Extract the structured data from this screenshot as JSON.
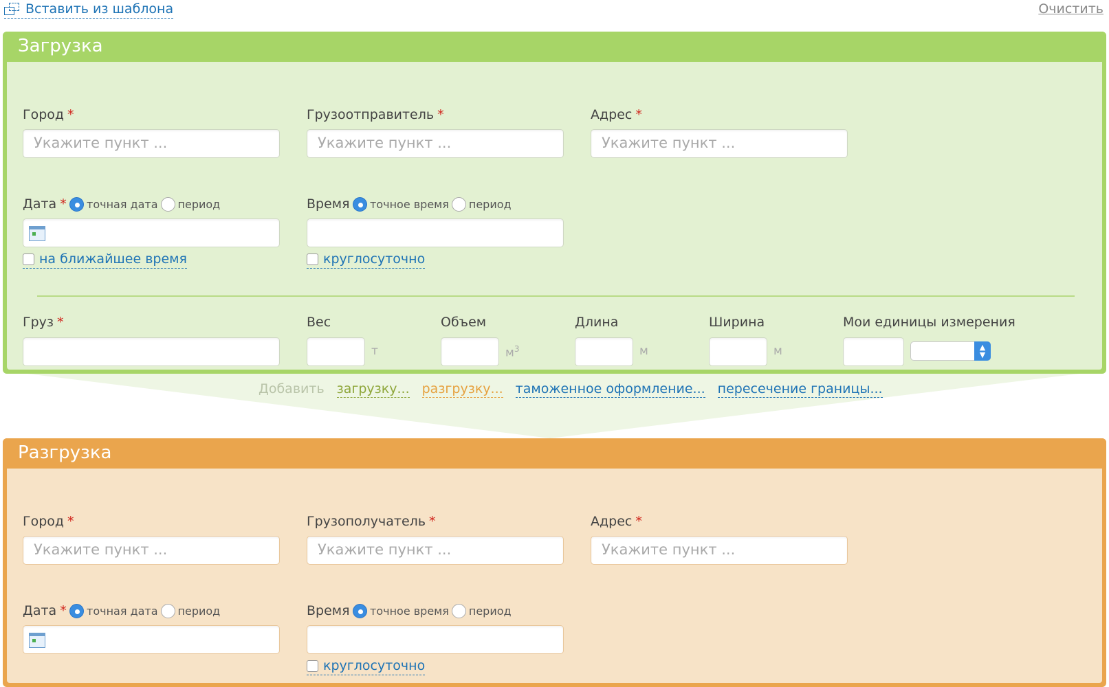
{
  "top": {
    "insert_template": "Вставить из шаблона",
    "clear": "Очистить"
  },
  "load": {
    "title": "Загрузка",
    "city_label": "Город",
    "shipper_label": "Грузоотправитель",
    "address_label": "Адрес",
    "placeholder": "Укажите пункт ...",
    "date_label": "Дата",
    "date_exact": "точная дата",
    "date_period": "период",
    "time_label": "Время",
    "time_exact": "точное время",
    "time_period": "период",
    "nearest_time": "на ближайшее время",
    "round_clock": "круглосуточно",
    "cargo_label": "Груз",
    "weight_label": "Вес",
    "weight_unit": "т",
    "volume_label": "Объем",
    "volume_unit": "м",
    "volume_exp": "3",
    "length_label": "Длина",
    "length_unit": "м",
    "width_label": "Ширина",
    "width_unit": "м",
    "my_units_label": "Мои единицы измерения",
    "required_mark": "*"
  },
  "add": {
    "label": "Добавить",
    "load": "загрузку...",
    "unload": "разгрузку...",
    "customs": "таможенное оформление...",
    "border": "пересечение границы..."
  },
  "unload": {
    "title": "Разгрузка",
    "city_label": "Город",
    "consignee_label": "Грузополучатель",
    "address_label": "Адрес",
    "placeholder": "Укажите пункт ...",
    "date_label": "Дата",
    "date_exact": "точная дата",
    "date_period": "период",
    "time_label": "Время",
    "time_exact": "точное время",
    "time_period": "период",
    "round_clock": "круглосуточно",
    "required_mark": "*"
  },
  "colors": {
    "load_accent": "#a7d567",
    "unload_accent": "#eaa54d",
    "link": "#1e73b5",
    "required": "#d0231b"
  }
}
